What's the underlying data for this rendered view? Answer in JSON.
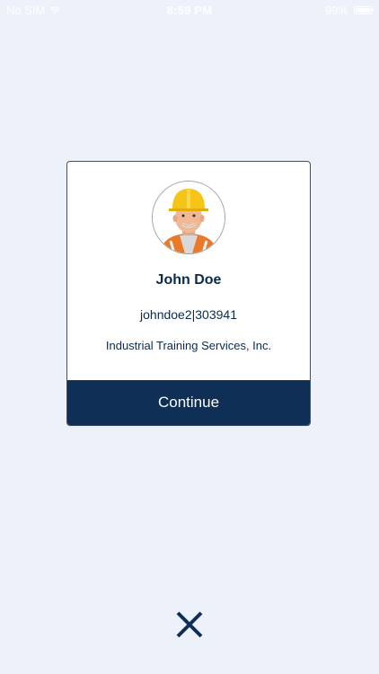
{
  "status_bar": {
    "carrier": "No SIM",
    "time": "8:59 PM",
    "battery": "99%",
    "wifi_icon": "wifi-icon",
    "battery_icon": "battery-icon"
  },
  "card": {
    "avatar_icon": "worker-avatar",
    "name": "John Doe",
    "user_id": "johndoe2|303941",
    "company": "Industrial Training Services, Inc.",
    "continue_label": "Continue",
    "button_color": "#0f2f56"
  },
  "close": {
    "icon": "close-icon"
  },
  "colors": {
    "background": "#edf1f9",
    "text": "#0b2a4e"
  }
}
